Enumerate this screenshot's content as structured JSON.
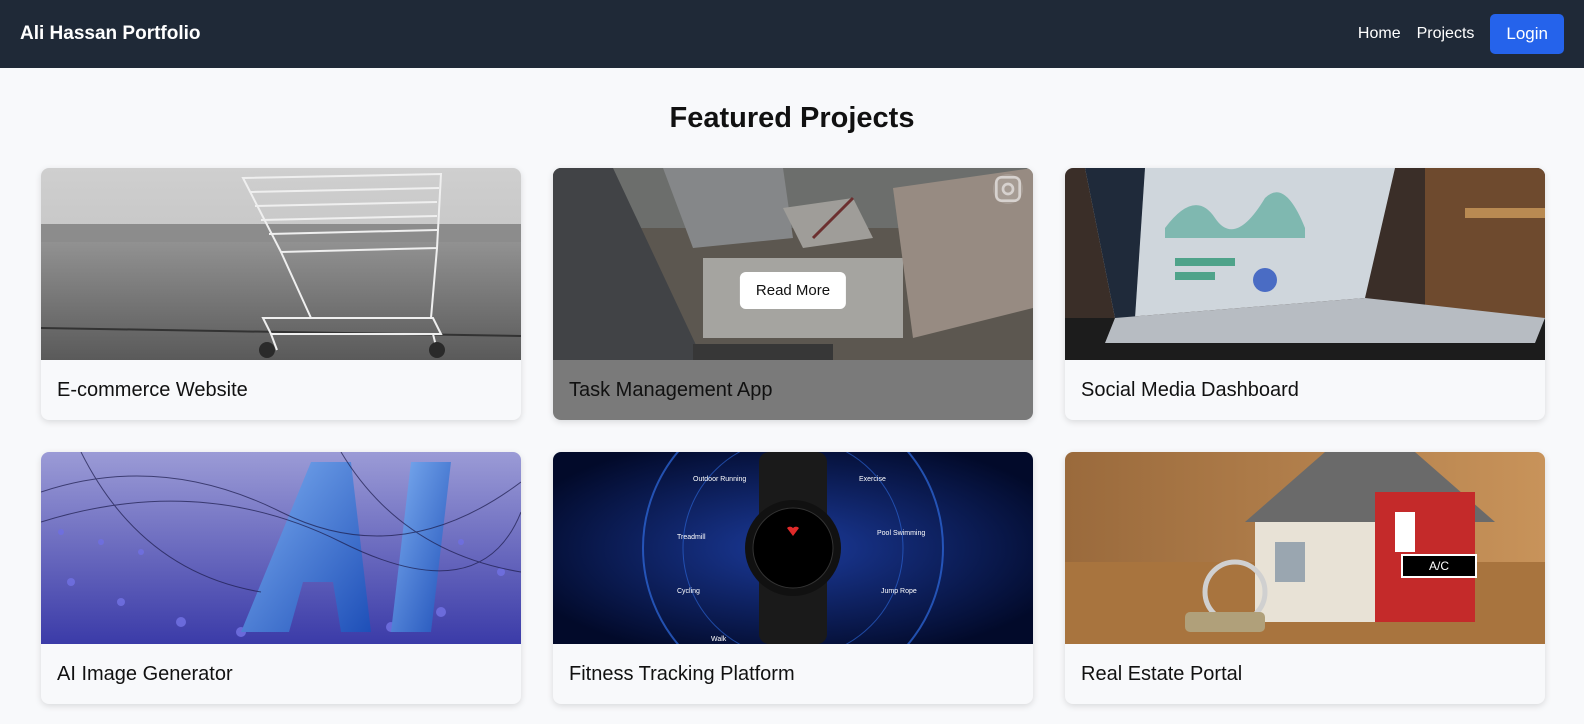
{
  "nav": {
    "brand": "Ali Hassan Portfolio",
    "links": [
      "Home",
      "Projects"
    ],
    "login_label": "Login"
  },
  "page": {
    "title": "Featured Projects"
  },
  "projects": [
    {
      "title": "E-commerce Website",
      "image": "shopping-cart-photo"
    },
    {
      "title": "Task Management App",
      "image": "meeting-desk-photo",
      "overlay_button": "Read More"
    },
    {
      "title": "Social Media Dashboard",
      "image": "laptop-dashboard-photo"
    },
    {
      "title": "AI Image Generator",
      "image": "ai-letters-photo"
    },
    {
      "title": "Fitness Tracking Platform",
      "image": "smartwatch-photo",
      "watch_labels": [
        "Outdoor Running",
        "Exercise",
        "Treadmill",
        "Pool Swimming",
        "Cycling",
        "Jump Rope",
        "Walk"
      ]
    },
    {
      "title": "Real Estate Portal",
      "image": "house-keys-photo",
      "badge": "A/C"
    }
  ],
  "colors": {
    "navbar": "#1f2937",
    "login": "#2563eb",
    "page_bg": "#f8f9fb"
  }
}
